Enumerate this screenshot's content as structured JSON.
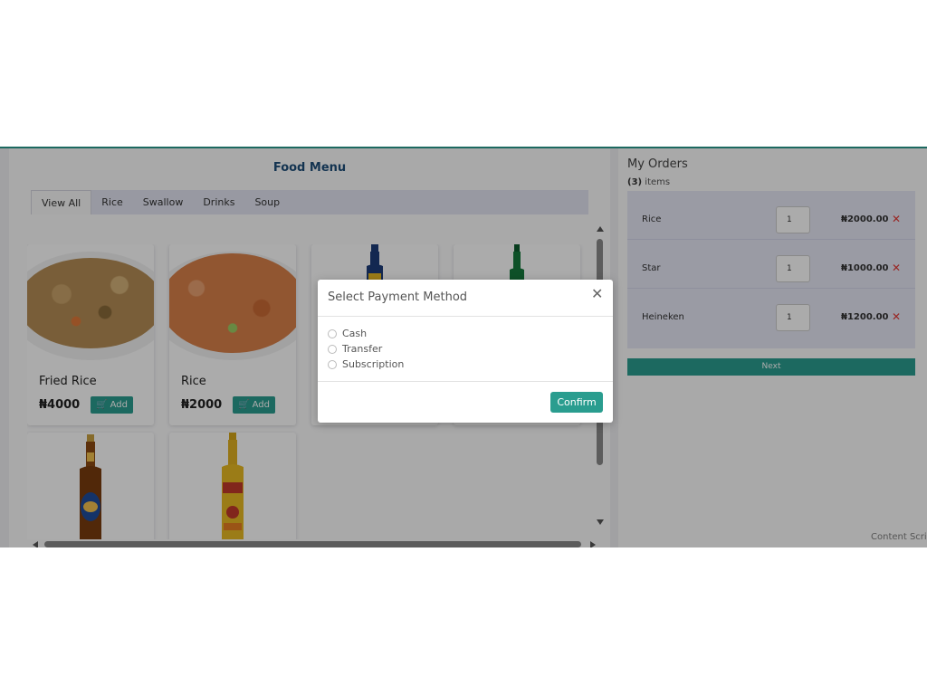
{
  "food_menu": {
    "title": "Food Menu",
    "tabs": [
      {
        "label": "View All",
        "active": true
      },
      {
        "label": "Rice"
      },
      {
        "label": "Swallow"
      },
      {
        "label": "Drinks"
      },
      {
        "label": "Soup"
      }
    ],
    "items": [
      {
        "name": "Fried Rice",
        "price": "₦4000",
        "add_label": "Add",
        "image": "fried-rice-image"
      },
      {
        "name": "Rice",
        "price": "₦2000",
        "add_label": "Add",
        "image": "jollof-rice-image"
      },
      {
        "name": "",
        "price": "",
        "image": "star-bottle-image"
      },
      {
        "name": "",
        "price": "",
        "image": "heineken-bottle-image"
      },
      {
        "name": "",
        "price": "",
        "image": "tiger-bottle-image"
      },
      {
        "name": "",
        "price": "",
        "image": "desperados-bottle-image"
      }
    ]
  },
  "orders": {
    "title": "My Orders",
    "count_value": "(3)",
    "count_suffix": " items",
    "items": [
      {
        "name": "Rice",
        "qty": "1",
        "price": "₦2000.00",
        "remove_icon": "close-icon"
      },
      {
        "name": "Star",
        "qty": "1",
        "price": "₦1000.00",
        "remove_icon": "close-icon"
      },
      {
        "name": "Heineken",
        "qty": "1",
        "price": "₦1200.00",
        "remove_icon": "close-icon"
      }
    ],
    "next_label": "Next"
  },
  "modal": {
    "title": "Select Payment Method",
    "options": [
      "Cash",
      "Transfer",
      "Subscription"
    ],
    "confirm_label": "Confirm"
  },
  "footer_text": "Content Scrip",
  "colors": {
    "accent": "#2a9d8f",
    "title_blue": "#1f4e79",
    "remove_red": "#e53935",
    "orders_bg": "#e6e7f5"
  }
}
